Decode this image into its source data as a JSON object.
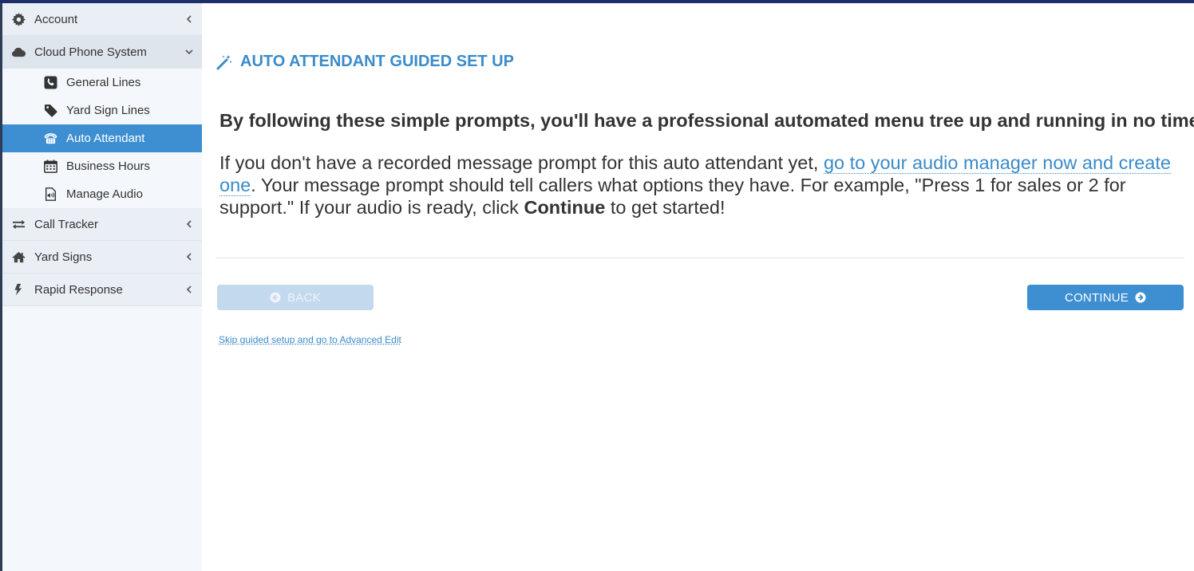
{
  "sidebar": {
    "items": [
      {
        "label": "Account",
        "icon": "gear-icon"
      },
      {
        "label": "Cloud Phone System",
        "icon": "cloud-icon",
        "expanded": true,
        "children": [
          {
            "label": "General Lines",
            "icon": "phone-icon"
          },
          {
            "label": "Yard Sign Lines",
            "icon": "tag-icon"
          },
          {
            "label": "Auto Attendant",
            "icon": "desk-phone-icon",
            "active": true
          },
          {
            "label": "Business Hours",
            "icon": "calendar-icon"
          },
          {
            "label": "Manage Audio",
            "icon": "audio-file-icon"
          }
        ]
      },
      {
        "label": "Call Tracker",
        "icon": "exchange-arrows-icon"
      },
      {
        "label": "Yard Signs",
        "icon": "home-icon"
      },
      {
        "label": "Rapid Response",
        "icon": "bolt-icon"
      }
    ]
  },
  "main": {
    "title": "AUTO ATTENDANT GUIDED SET UP",
    "lead": "By following these simple prompts, you'll have a professional automated menu tree up and running in no time!",
    "desc_part1": "If you don't have a recorded message prompt for this auto attendant yet, ",
    "desc_link": "go to your audio manager now and create one",
    "desc_part2": ". Your message prompt should tell callers what options they have. For example, \"Press 1 for sales or 2 for support.\" If your audio is ready, click ",
    "desc_bold": "Continue",
    "desc_part3": " to get started!",
    "back_label": "BACK",
    "continue_label": "CONTINUE",
    "skip_label": "Skip guided setup and go to Advanced Edit"
  },
  "colors": {
    "accent": "#3d8fd1",
    "title": "#3a8bc9",
    "topbar": "#1c2f6b",
    "back_disabled": "#c3d9ee"
  }
}
